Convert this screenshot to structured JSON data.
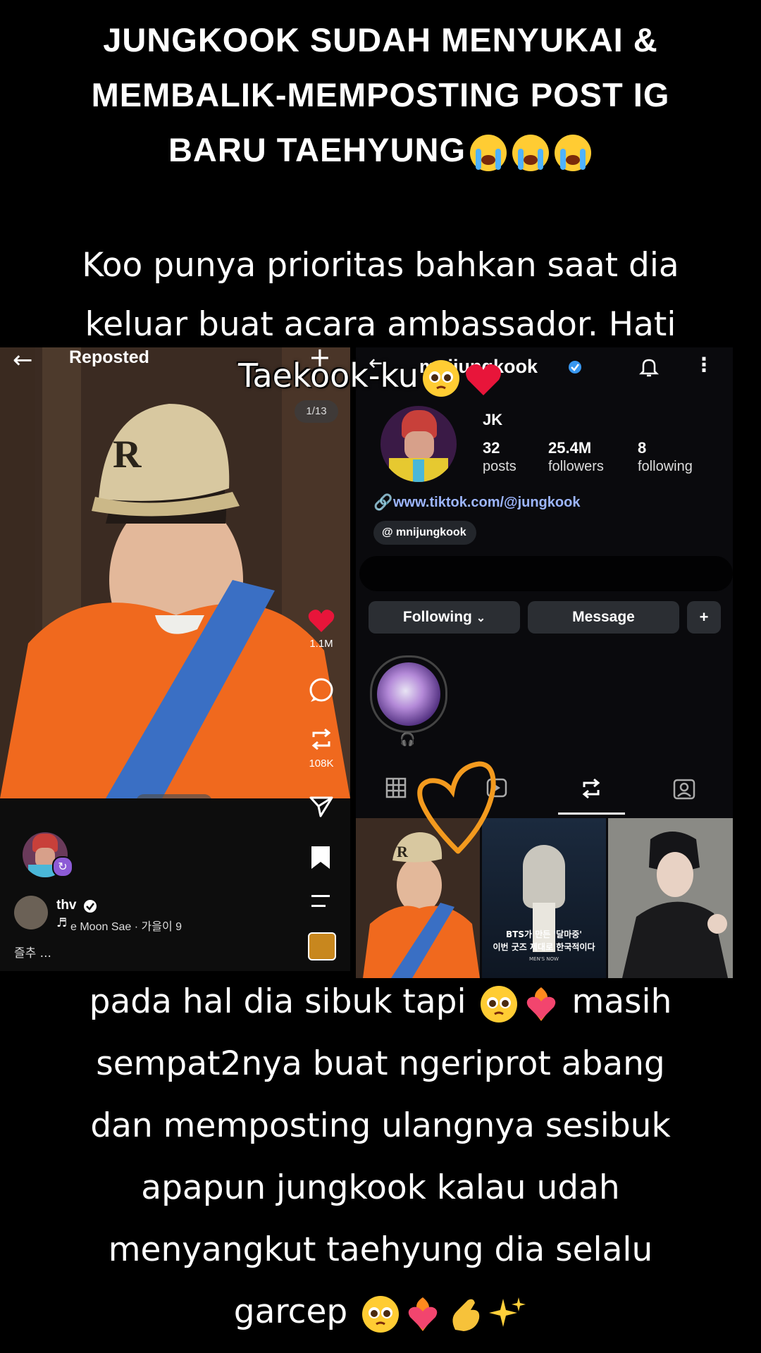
{
  "headline": {
    "line1": "JUNGKOOK SUDAH MENYUKAI &",
    "line2": "MEMBALIK-MEMPOSTING POST IG",
    "line3": "BARU TAEHYUNG"
  },
  "caption_top": {
    "line1": "Koo punya prioritas bahkan saat dia",
    "line2": "keluar buat acara ambassador. Hati",
    "overlay": "Taekook-ku"
  },
  "caption_bottom": {
    "line1": "pada hal dia sibuk tapi",
    "line1b": "masih",
    "line2": "sempat2nya buat ngeriprot abang",
    "line3": "dan memposting ulangnya sesibuk",
    "line4": "apapun jungkook kalau udah",
    "line5": "menyangkut taehyung dia selalu",
    "line6": "garcep"
  },
  "left_post": {
    "back_icon": "arrow-left-icon",
    "title": "Reposted",
    "add_icon": "plus-icon",
    "counter": "1/13",
    "likes": "1.1M",
    "reposts": "108K",
    "username": "thv",
    "music": "e Moon Sae · 가을이 9",
    "caption": "즐추 ..."
  },
  "right_profile": {
    "username": "mnijungkook",
    "name": "JK",
    "posts_n": "32",
    "posts_l": "posts",
    "followers_n": "25.4M",
    "followers_l": "followers",
    "following_n": "8",
    "following_l": "following",
    "link": "www.tiktok.com/@jungkook",
    "threads": "mnijungkook",
    "following_btn": "Following",
    "message_btn": "Message",
    "tile2_line1": "BTS가 만든 '달마중'",
    "tile2_line2": "이번 굿즈 제대로 한국적이다",
    "tile2_line3": "MEN'S NOW"
  },
  "colors": {
    "background": "#000000",
    "heart_red": "#e8153a",
    "verified_blue": "#3897f0",
    "link_blue": "#9db6ff",
    "doodle_orange": "#f39a1e",
    "sweater_orange": "#f0691e"
  }
}
